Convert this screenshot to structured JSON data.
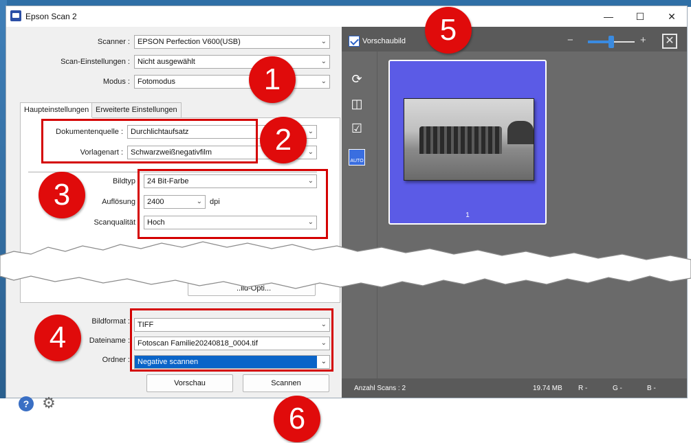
{
  "window": {
    "title": "Epson Scan 2",
    "minimize": "—",
    "maximize": "☐",
    "close": "✕"
  },
  "settings": {
    "scanner_label": "Scanner :",
    "scanner_value": "EPSON Perfection V600(USB)",
    "scan_settings_label": "Scan-Einstellungen :",
    "scan_settings_value": "Nicht ausgewählt",
    "mode_label": "Modus :",
    "mode_value": "Fotomodus"
  },
  "tabs": {
    "main": "Haupteinstellungen",
    "advanced": "Erweiterte Einstellungen"
  },
  "main_settings": {
    "doc_source_label": "Dokumentenquelle :",
    "doc_source_value": "Durchlichtaufsatz",
    "template_label": "Vorlagenart :",
    "template_value": "Schwarzweißnegativfilm",
    "image_type_label": "Bildtyp",
    "image_type_value": "24 Bit-Farbe",
    "resolution_label": "Auflösung",
    "resolution_value": "2400",
    "resolution_unit": "dpi",
    "quality_label": "Scanqualität",
    "quality_value": "Hoch",
    "partial_button": "..ild-Opti..."
  },
  "output": {
    "format_label": "Bildformat :",
    "format_value": "TIFF",
    "filename_label": "Dateiname :",
    "filename_value": "Fotoscan Familie20240818_0004.tif",
    "folder_label": "Ordner :",
    "folder_value": "Negative scannen"
  },
  "buttons": {
    "preview": "Vorschau",
    "scan": "Scannen"
  },
  "preview": {
    "thumbnail_checkbox": "Vorschaubild",
    "zoom_out": "−",
    "zoom_in": "+",
    "zoom_level": 0.45,
    "close": "✕",
    "thumbnail_number": "1",
    "status_count": "Anzahl Scans : 2",
    "status_size": "19.74 MB",
    "status_r": "R  -",
    "status_g": "G  -",
    "status_b": "B  -"
  },
  "badges": [
    "1",
    "2",
    "3",
    "4",
    "5",
    "6"
  ],
  "colors": {
    "annotation_red": "#d40000",
    "badge_red": "#e00b0b",
    "thumbnail_blue": "#5b5be6",
    "selection_blue": "#0a64c8"
  }
}
